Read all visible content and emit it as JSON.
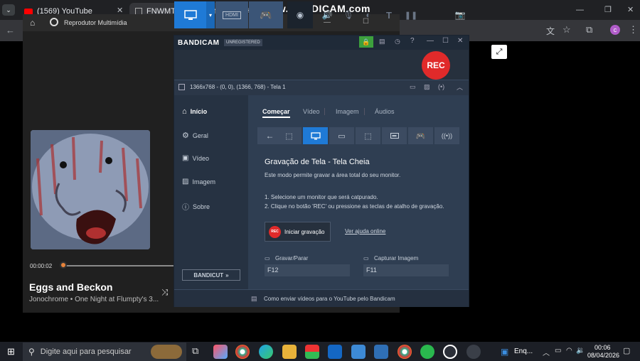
{
  "browser": {
    "tabs": [
      {
        "label": "(1569) YouTube"
      },
      {
        "label": "FNWMT NA Recodificado Jogo"
      }
    ],
    "new_tab": "+",
    "watermark": "www.BANDICAM.com"
  },
  "player": {
    "app_title": "Reprodutor Multimídia",
    "elapsed": "00:00:02",
    "song_title": "Eggs and Beckon",
    "song_subtitle": "Jonochrome • One Night at Flumpty's 3...",
    "progress": 0.05
  },
  "bandicam": {
    "brand": "BANDICAM",
    "badge": "UNREGISTERED",
    "rec_label": "REC",
    "hdmi_label": "HDMI",
    "selection": "1366x768 - (0, 0), (1366, 768) - Tela 1",
    "sidebar": [
      {
        "label": "Início"
      },
      {
        "label": "Geral"
      },
      {
        "label": "Vídeo"
      },
      {
        "label": "Imagem"
      },
      {
        "label": "Sobre"
      }
    ],
    "bandicut": "BANDICUT",
    "tabs": [
      {
        "label": "Começar"
      },
      {
        "label": "Vídeo"
      },
      {
        "label": "Imagem"
      },
      {
        "label": "Áudios"
      }
    ],
    "heading": "Gravação de Tela - Tela Cheia",
    "description": "Este modo permite gravar a área total do seu monitor.",
    "step1": "1. Selecione um monitor que será catpurado.",
    "step2": "2. Clique no botão 'REC' ou pressione as teclas de atalho de gravação.",
    "start_button": "Iniciar gravação",
    "help_link": "Ver ajuda online",
    "hotkey_record_label": "Gravar/Parar",
    "hotkey_record_value": "F12",
    "hotkey_capture_label": "Capturar Imagem",
    "hotkey_capture_value": "F11",
    "footer": "Como enviar vídeos para o YouTube pelo Bandicam"
  },
  "taskbar": {
    "search_placeholder": "Digite aqui para pesquisar",
    "weather": "Enq...",
    "time": "00:06",
    "date": "08/04/2026"
  },
  "colors": {
    "accent_blue": "#1f7ad6",
    "rec_red": "#e02a2a",
    "lock_green": "#3da03d"
  }
}
